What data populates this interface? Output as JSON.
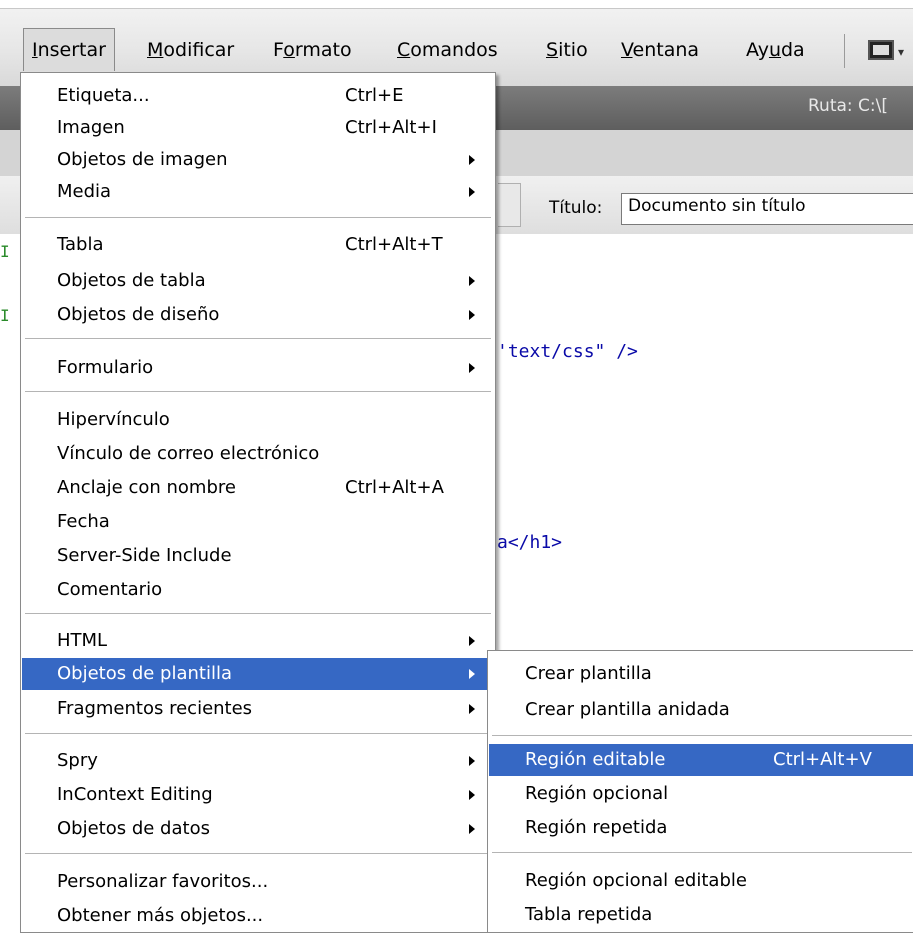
{
  "menubar": {
    "items": [
      {
        "pre": "",
        "u": "I",
        "post": "nsertar"
      },
      {
        "pre": "",
        "u": "M",
        "post": "odificar"
      },
      {
        "pre": "F",
        "u": "o",
        "post": "rmato"
      },
      {
        "pre": "",
        "u": "C",
        "post": "omandos"
      },
      {
        "pre": "",
        "u": "S",
        "post": "itio"
      },
      {
        "pre": "",
        "u": "V",
        "post": "entana"
      },
      {
        "pre": "Ay",
        "u": "u",
        "post": "da"
      }
    ]
  },
  "document": {
    "ruta": "Ruta: C:\\[",
    "title_label": "Título:",
    "title_value": "Documento sin título",
    "code_lines": [
      "'text/css\" />",
      "a</h1>"
    ]
  },
  "insert_menu": {
    "items": [
      {
        "label": "Etiqueta...",
        "shortcut": "Ctrl+E"
      },
      {
        "label": "Imagen",
        "shortcut": "Ctrl+Alt+I"
      },
      {
        "label": "Objetos de imagen",
        "submenu": true
      },
      {
        "label": "Media",
        "submenu": true
      },
      {
        "label": "Tabla",
        "shortcut": "Ctrl+Alt+T"
      },
      {
        "label": "Objetos de tabla",
        "submenu": true
      },
      {
        "label": "Objetos de diseño",
        "submenu": true
      },
      {
        "label": "Formulario",
        "submenu": true
      },
      {
        "label": "Hipervínculo"
      },
      {
        "label": "Vínculo de correo electrónico"
      },
      {
        "label": "Anclaje con nombre",
        "shortcut": "Ctrl+Alt+A"
      },
      {
        "label": "Fecha"
      },
      {
        "label": "Server-Side Include"
      },
      {
        "label": "Comentario"
      },
      {
        "label": "HTML",
        "submenu": true
      },
      {
        "label": "Objetos de plantilla",
        "submenu": true,
        "highlighted": true
      },
      {
        "label": "Fragmentos recientes",
        "submenu": true
      },
      {
        "label": "Spry",
        "submenu": true
      },
      {
        "label": "InContext Editing",
        "submenu": true
      },
      {
        "label": "Objetos de datos",
        "submenu": true
      },
      {
        "label": "Personalizar favoritos..."
      },
      {
        "label": "Obtener más objetos..."
      }
    ]
  },
  "template_submenu": {
    "items": [
      {
        "label": "Crear plantilla"
      },
      {
        "label": "Crear plantilla anidada"
      },
      {
        "label": "Región editable",
        "shortcut": "Ctrl+Alt+V",
        "highlighted": true
      },
      {
        "label": "Región opcional"
      },
      {
        "label": "Región repetida"
      },
      {
        "label": "Región opcional editable"
      },
      {
        "label": "Tabla repetida"
      }
    ]
  },
  "colors": {
    "highlight": "#3668c4",
    "code": "#0a0aa8"
  }
}
